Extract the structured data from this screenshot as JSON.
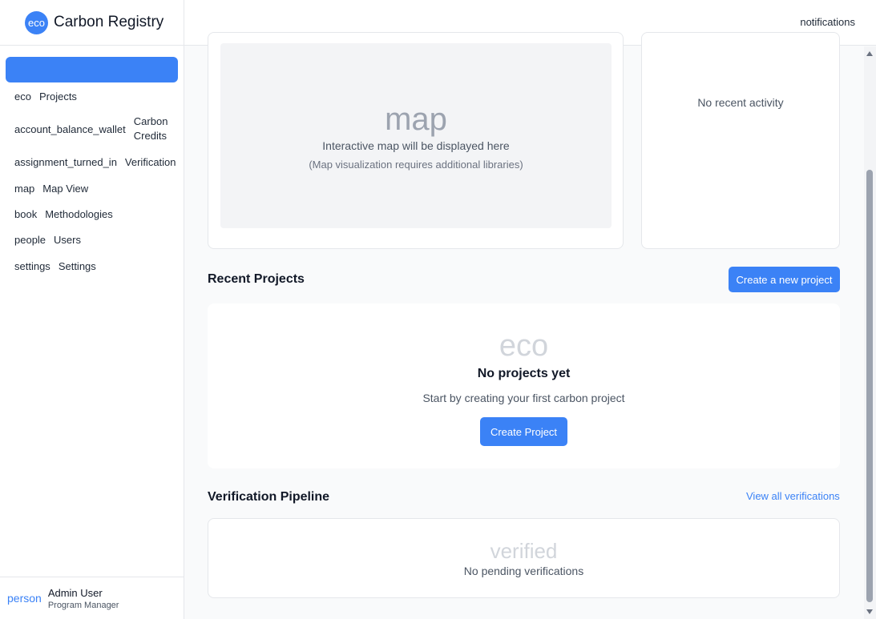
{
  "brand": {
    "logo_text": "eco",
    "title": "Carbon Registry"
  },
  "sidebar": {
    "items": [
      {
        "icon": "eco",
        "label": "Projects"
      },
      {
        "icon": "account_balance_wallet",
        "label": "Carbon Credits"
      },
      {
        "icon": "assignment_turned_in",
        "label": "Verification"
      },
      {
        "icon": "map",
        "label": "Map View"
      },
      {
        "icon": "book",
        "label": "Methodologies"
      },
      {
        "icon": "people",
        "label": "Users"
      },
      {
        "icon": "settings",
        "label": "Settings"
      }
    ]
  },
  "user": {
    "icon": "person",
    "name": "Admin User",
    "role": "Program Manager"
  },
  "header": {
    "notifications": "notifications"
  },
  "map": {
    "icon": "map",
    "text": "Interactive map will be displayed here",
    "subtext": "(Map visualization requires additional libraries)"
  },
  "activity": {
    "empty": "No recent activity"
  },
  "recent_projects": {
    "title": "Recent Projects",
    "create_button": "Create a new project",
    "empty_icon": "eco",
    "empty_title": "No projects yet",
    "empty_subtitle": "Start by creating your first carbon project",
    "cta": "Create Project"
  },
  "verification": {
    "title": "Verification Pipeline",
    "link": "View all verifications",
    "empty_icon": "verified",
    "empty_text": "No pending verifications"
  },
  "colors": {
    "primary": "#3b82f6",
    "muted_icon": "#d1d5db"
  }
}
